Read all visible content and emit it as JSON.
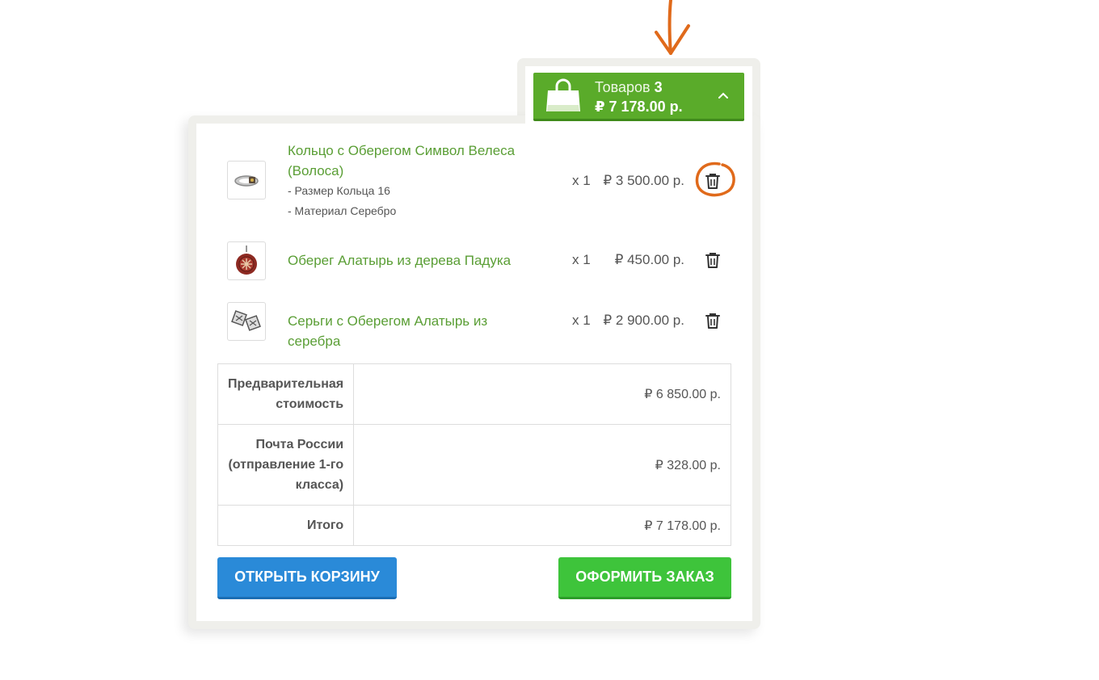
{
  "cart": {
    "items_label": "Товаров",
    "items_count": "3",
    "total": "₽ 7 178.00 р."
  },
  "items": [
    {
      "name": "Кольцо с Оберегом Символ Велеса (Волоса)",
      "options": [
        "- Размер Кольца 16",
        "- Материал Серебро"
      ],
      "qty": "x 1",
      "price": "₽ 3 500.00 р."
    },
    {
      "name": "Оберег Алатырь из дерева Падука",
      "options": [],
      "qty": "x 1",
      "price": "₽ 450.00 р."
    },
    {
      "name": "Серьги с Оберегом Алатырь из серебра",
      "options": [],
      "qty": "x 1",
      "price": "₽ 2 900.00 р."
    }
  ],
  "totals": [
    {
      "label": "Предварительная стоимость",
      "value": "₽ 6 850.00 р."
    },
    {
      "label": "Почта России (отправление 1-го класса)",
      "value": "₽ 328.00 р."
    },
    {
      "label": "Итого",
      "value": "₽ 7 178.00 р."
    }
  ],
  "buttons": {
    "open_cart": "ОТКРЫТЬ КОРЗИНУ",
    "checkout": "ОФОРМИТЬ ЗАКАЗ"
  },
  "icons": {
    "cart": "shopping-bag-icon",
    "toggle": "chevron-up-icon",
    "remove": "trash-icon"
  },
  "colors": {
    "accent_green": "#5aab2a",
    "link_green": "#5a9e35",
    "button_blue": "#2a8ad8",
    "button_green": "#3ec43b",
    "annotation_orange": "#e06a1b"
  }
}
